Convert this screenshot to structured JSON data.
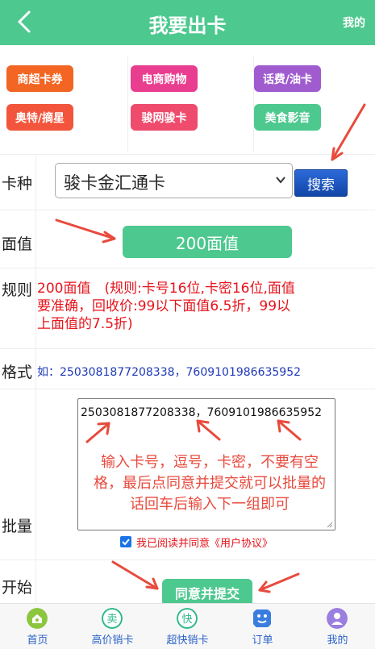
{
  "header": {
    "title": "我要出卡",
    "right_link": "我的"
  },
  "categories": [
    {
      "label": "商超卡券",
      "color": "#f26522"
    },
    {
      "label": "电商购物",
      "color": "#e93d8f"
    },
    {
      "label": "话费/油卡",
      "color": "#a05ccf"
    },
    {
      "label": "奥特/摘星",
      "color": "#f2553c"
    },
    {
      "label": "骏网骏卡",
      "color": "#ee4b6d"
    },
    {
      "label": "美食影音",
      "color": "#4dc88f"
    }
  ],
  "form": {
    "card_type_label": "卡种",
    "card_type_value": "骏卡金汇通卡",
    "search_button": "搜索",
    "value_label": "面值",
    "value_selected": "200面值",
    "rule_label": "规则",
    "rule_text": "200面值　(规则:卡号16位,卡密16位,面值要准确，回收价:99以下面值6.5折，99以上面值的7.5折)",
    "format_label": "格式",
    "format_text": "如：2503081877208338，7609101986635952",
    "batch_label": "批量",
    "batch_value": "2503081877208338，7609101986635952",
    "batch_hint": "输入卡号，逗号，卡密，不要有空格，最后点同意并提交就可以批量的话回车后输入下一组即可",
    "agree_prefix": "我已阅读并同意",
    "agree_link": "《用户协议》",
    "start_label": "开始",
    "submit_button": "同意并提交"
  },
  "tabbar": {
    "items": [
      {
        "label": "首页",
        "icon": "home-icon",
        "color": "#8cc63f"
      },
      {
        "label": "高价销卡",
        "icon": "sell-icon",
        "color": "#2db88a"
      },
      {
        "label": "超快销卡",
        "icon": "fast-icon",
        "color": "#2db88a"
      },
      {
        "label": "订单",
        "icon": "order-icon",
        "color": "#3a7de0"
      },
      {
        "label": "我的",
        "icon": "profile-icon",
        "color": "#9a7ee0"
      }
    ]
  }
}
